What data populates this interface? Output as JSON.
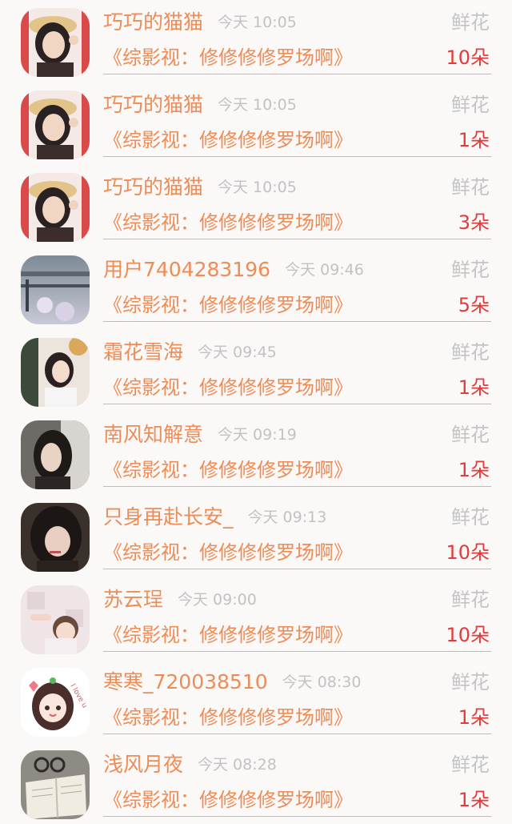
{
  "rows": [
    {
      "name": "巧巧的猫猫",
      "time": "今天 10:05",
      "gift_type": "鲜花",
      "title": "《综影视：修修修修罗场啊》",
      "count": "10朵",
      "avatar": "avatar-hat-girl-1"
    },
    {
      "name": "巧巧的猫猫",
      "time": "今天 10:05",
      "gift_type": "鲜花",
      "title": "《综影视：修修修修罗场啊》",
      "count": "1朵",
      "avatar": "avatar-hat-girl-2"
    },
    {
      "name": "巧巧的猫猫",
      "time": "今天 10:05",
      "gift_type": "鲜花",
      "title": "《综影视：修修修修罗场啊》",
      "count": "3朵",
      "avatar": "avatar-hat-girl-3"
    },
    {
      "name": "用户7404283196",
      "time": "今天 09:46",
      "gift_type": "鲜花",
      "title": "《综影视：修修修修罗场啊》",
      "count": "5朵",
      "avatar": "avatar-landscape"
    },
    {
      "name": "霜花雪海",
      "time": "今天 09:45",
      "gift_type": "鲜花",
      "title": "《综影视：修修修修罗场啊》",
      "count": "1朵",
      "avatar": "avatar-girl-lying"
    },
    {
      "name": "南风知解意",
      "time": "今天 09:19",
      "gift_type": "鲜花",
      "title": "《综影视：修修修修罗场啊》",
      "count": "1朵",
      "avatar": "avatar-girl-profile"
    },
    {
      "name": "只身再赴长安_",
      "time": "今天 09:13",
      "gift_type": "鲜花",
      "title": "《综影视：修修修修罗场啊》",
      "count": "10朵",
      "avatar": "avatar-dark-hair-girl"
    },
    {
      "name": "苏云珵",
      "time": "今天 09:00",
      "gift_type": "鲜花",
      "title": "《综影视：修修修修罗场啊》",
      "count": "10朵",
      "avatar": "avatar-baby"
    },
    {
      "name": "寒寒_720038510",
      "time": "今天 08:30",
      "gift_type": "鲜花",
      "title": "《综影视：修修修修罗场啊》",
      "count": "1朵",
      "avatar": "avatar-anime-girl"
    },
    {
      "name": "浅风月夜",
      "time": "今天 08:28",
      "gift_type": "鲜花",
      "title": "《综影视：修修修修罗场啊》",
      "count": "1朵",
      "avatar": "avatar-book"
    }
  ],
  "colors": {
    "name": "#ee8c56",
    "title": "#ee8c56",
    "count": "#e23b3b",
    "muted": "#c2c2c2",
    "background": "#fbf8f8"
  },
  "avatar_ornaments": {
    "anime_love_text": "I love u"
  }
}
